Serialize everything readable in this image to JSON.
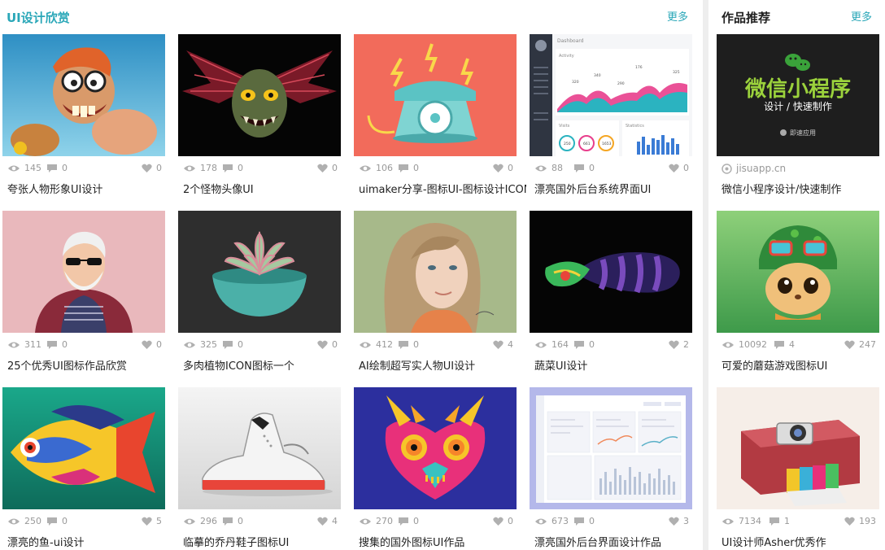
{
  "main": {
    "section_title": "UI设计欣赏",
    "more_label": "更多",
    "cards": [
      {
        "title": "夸张人物形象UI设计",
        "views": "145",
        "comments": "0",
        "likes": "0"
      },
      {
        "title": "2个怪物头像UI",
        "views": "178",
        "comments": "0",
        "likes": "0"
      },
      {
        "title": "uimaker分享-图标UI-图标设计ICON",
        "views": "106",
        "comments": "0",
        "likes": "0"
      },
      {
        "title": "漂亮国外后台系统界面UI",
        "views": "88",
        "comments": "0",
        "likes": "0"
      },
      {
        "title": "25个优秀UI图标作品欣赏",
        "views": "311",
        "comments": "0",
        "likes": "0"
      },
      {
        "title": "多肉植物ICON图标一个",
        "views": "325",
        "comments": "0",
        "likes": "0"
      },
      {
        "title": "AI绘制超写实人物UI设计",
        "views": "412",
        "comments": "0",
        "likes": "4"
      },
      {
        "title": "蔬菜UI设计",
        "views": "164",
        "comments": "0",
        "likes": "2"
      },
      {
        "title": "漂亮的鱼-ui设计",
        "views": "250",
        "comments": "0",
        "likes": "5"
      },
      {
        "title": "临摹的乔丹鞋子图标UI",
        "views": "296",
        "comments": "0",
        "likes": "4"
      },
      {
        "title": "搜集的国外图标UI作品",
        "views": "270",
        "comments": "0",
        "likes": "0"
      },
      {
        "title": "漂亮国外后台界面设计作品",
        "views": "673",
        "comments": "0",
        "likes": "3"
      }
    ]
  },
  "side": {
    "section_title": "作品推荐",
    "more_label": "更多",
    "ad": {
      "headline": "微信小程序",
      "subline": "设计 / 快速制作",
      "tag": "即速应用",
      "site": "jisuapp.cn",
      "title": "微信小程序设计/快速制作"
    },
    "cards": [
      {
        "title": "可爱的蘑菇游戏图标UI",
        "views": "10092",
        "comments": "4",
        "likes": "247"
      },
      {
        "title": "UI设计师Asher优秀作",
        "views": "7134",
        "comments": "1",
        "likes": "193"
      }
    ]
  },
  "thumb_mockup_text": {
    "dashboard_label": "Dashboard",
    "activity_label": "Activity",
    "visits_label": "Visits",
    "statistics_label": "Statistics",
    "chart_values": [
      "320",
      "340",
      "290",
      "176",
      "325"
    ],
    "ring_values": [
      "250",
      "661",
      "1653"
    ]
  },
  "colors": {
    "accent": "#2aa7b8",
    "ad_headline": "#9bd23c",
    "muted": "#999999"
  }
}
